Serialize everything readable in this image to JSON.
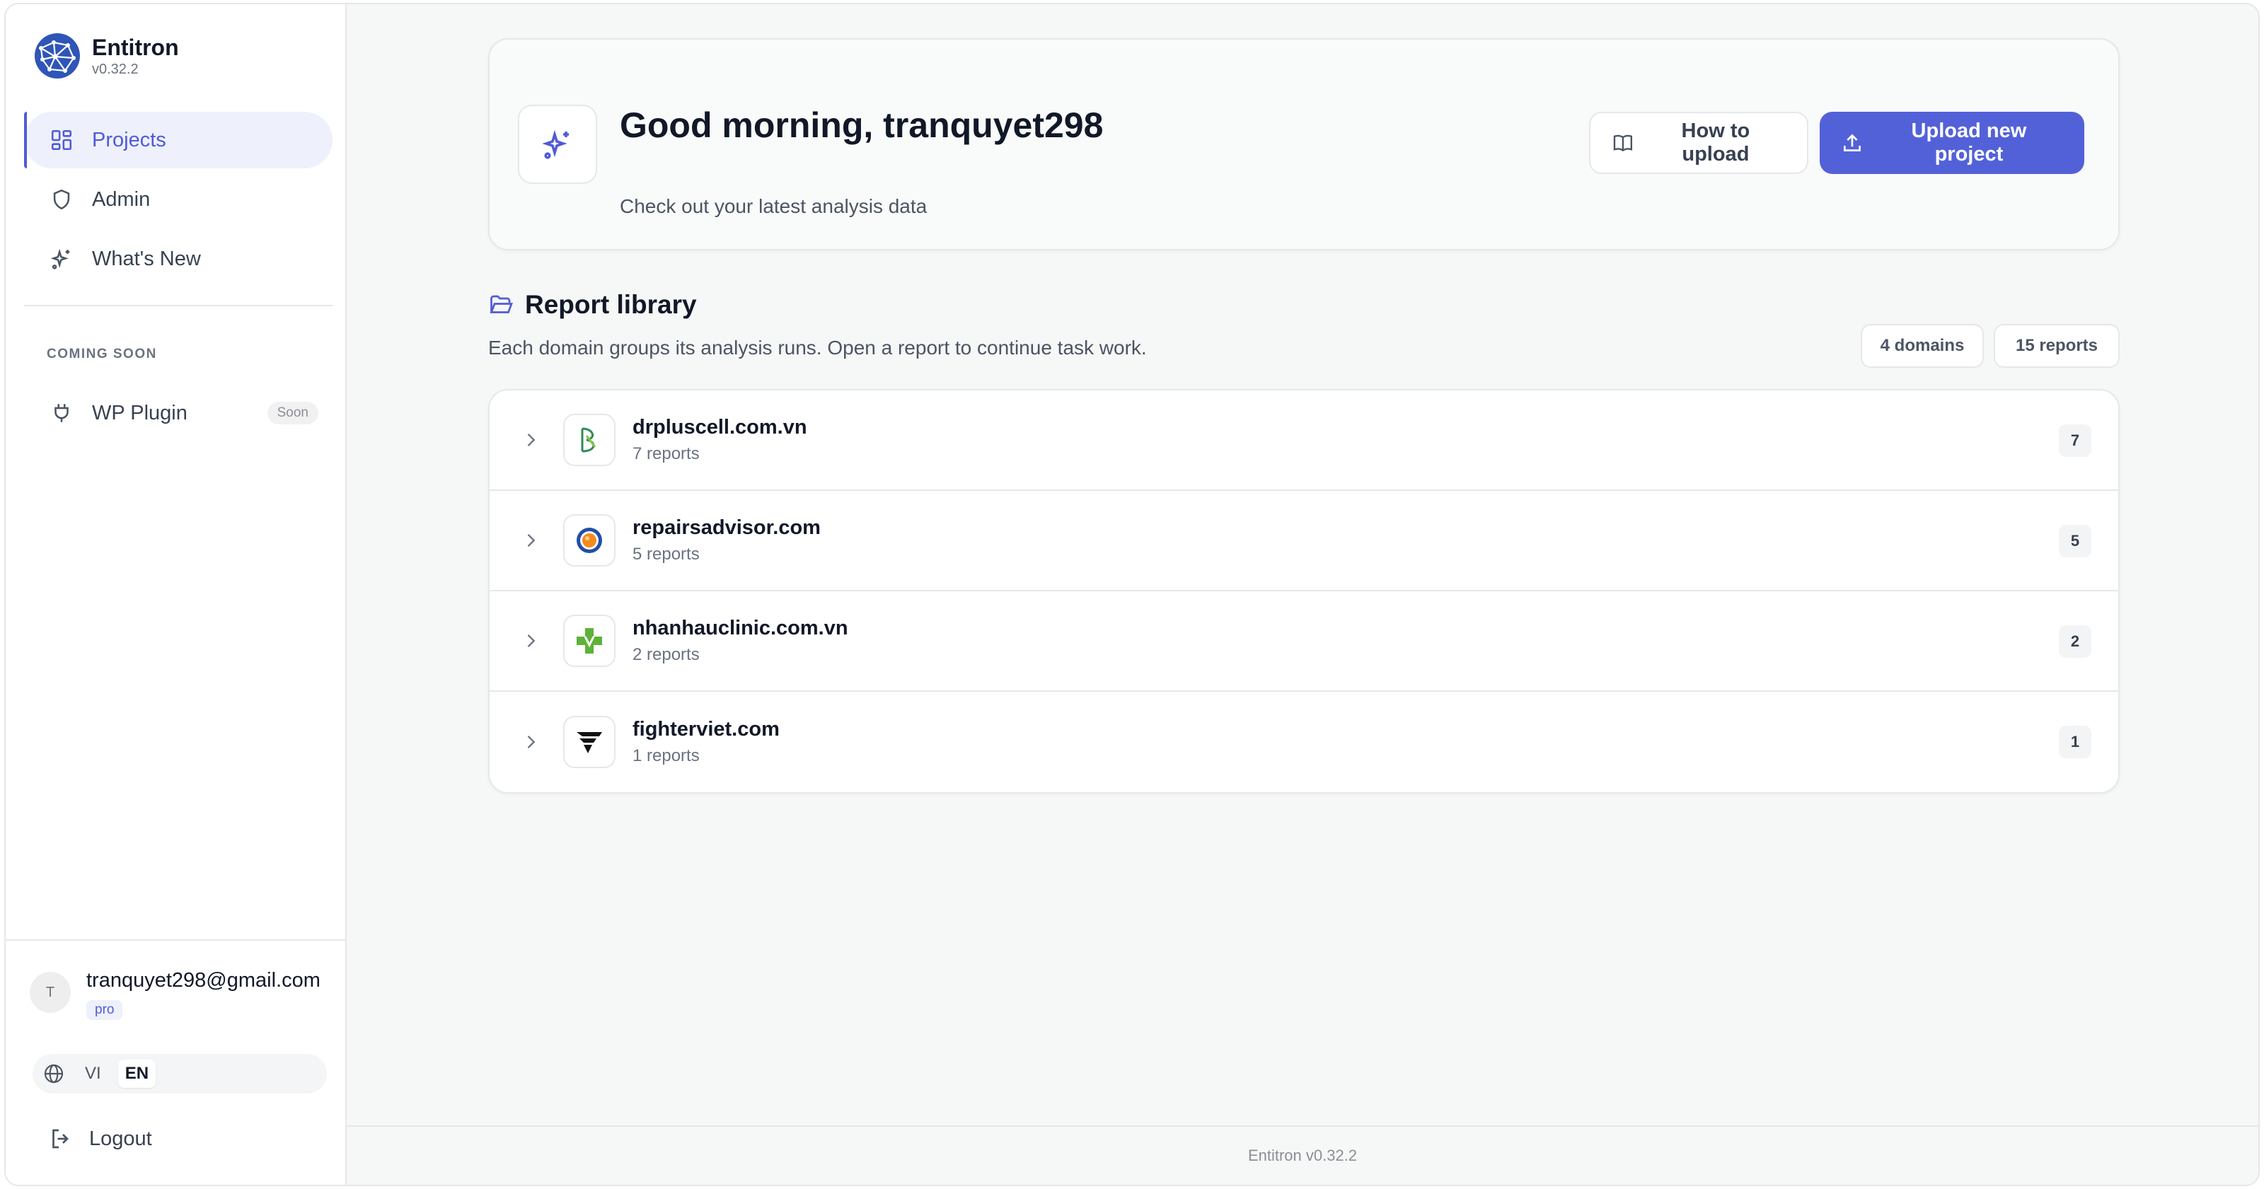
{
  "brand": {
    "name": "Entitron",
    "version": "v0.32.2",
    "accent": "#4f5bd5"
  },
  "nav": {
    "items": [
      {
        "label": "Projects",
        "icon": "grid-icon",
        "active": true
      },
      {
        "label": "Admin",
        "icon": "shield-icon",
        "active": false
      },
      {
        "label": "What's New",
        "icon": "sparkles-icon",
        "active": false
      }
    ],
    "coming_soon_label": "COMING SOON",
    "plugin": {
      "label": "WP Plugin",
      "badge": "Soon",
      "icon": "plug-icon"
    }
  },
  "user": {
    "avatar_letter": "T",
    "email": "tranquyet298@gmail.com",
    "plan": "pro"
  },
  "language": {
    "options": [
      "VI",
      "EN"
    ],
    "selected": "EN"
  },
  "logout_label": "Logout",
  "hero": {
    "title": "Good morning, tranquyet298",
    "subtitle": "Check out your latest analysis data",
    "how_to_label": "How to upload",
    "upload_label": "Upload new project"
  },
  "library": {
    "title": "Report library",
    "description": "Each domain groups its analysis runs. Open a report to continue task work.",
    "domains_badge": "4 domains",
    "reports_badge": "15 reports",
    "rows": [
      {
        "domain": "drpluscell.com.vn",
        "reports_label": "7 reports",
        "count": "7"
      },
      {
        "domain": "repairsadvisor.com",
        "reports_label": "5 reports",
        "count": "5"
      },
      {
        "domain": "nhanhauclinic.com.vn",
        "reports_label": "2 reports",
        "count": "2"
      },
      {
        "domain": "fighterviet.com",
        "reports_label": "1 reports",
        "count": "1"
      }
    ]
  },
  "footer": {
    "text": "Entitron v0.32.2"
  }
}
